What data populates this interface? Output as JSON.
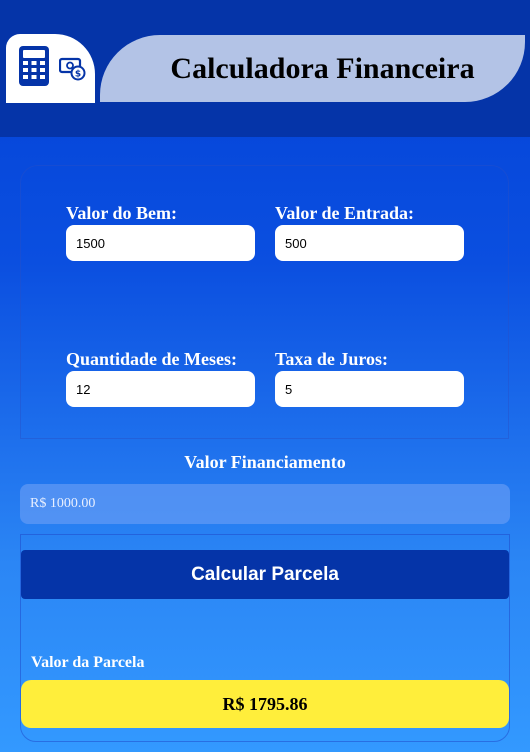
{
  "header": {
    "title": "Calculadora Financeira"
  },
  "form": {
    "valor_bem": {
      "label": "Valor do Bem:",
      "value": "1500"
    },
    "valor_entrada": {
      "label": "Valor de Entrada:",
      "value": "500"
    },
    "quantidade_meses": {
      "label": "Quantidade de Meses:",
      "value": "12"
    },
    "taxa_juros": {
      "label": "Taxa de Juros:",
      "value": "5"
    }
  },
  "financiamento": {
    "label": "Valor Financiamento",
    "value": "R$ 1000.00"
  },
  "result": {
    "button_label": "Calcular Parcela",
    "parcela_label": "Valor da Parcela",
    "parcela_value": "R$ 1795.86"
  },
  "colors": {
    "header_bg": "#0534a8",
    "title_bg": "#b3c3e6",
    "button_bg": "#0534a8",
    "result_bg": "#ffee3b"
  },
  "icons": [
    "calculator-icon",
    "money-exchange-icon"
  ]
}
